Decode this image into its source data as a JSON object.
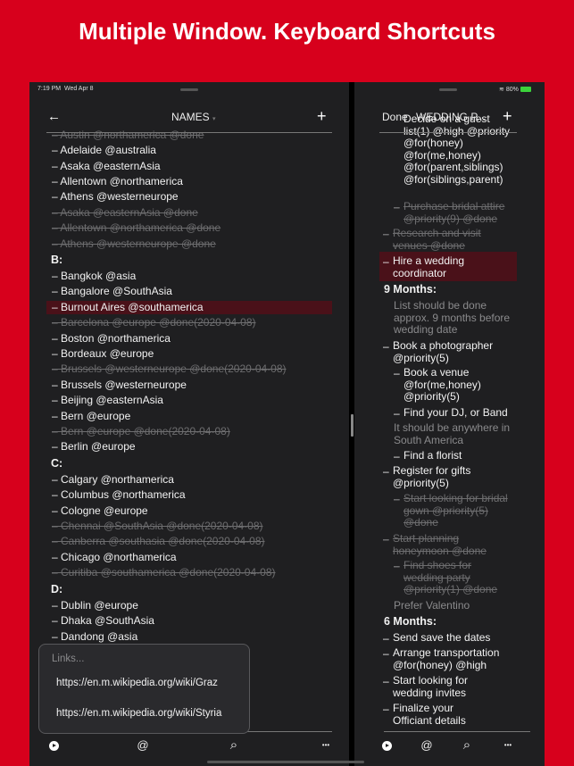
{
  "headline": "Multiple Window. Keyboard Shortcuts",
  "status": {
    "time": "7:19 PM",
    "date": "Wed Apr 8",
    "battery": "80%",
    "wifi_icon": "wifi-icon",
    "battery_icon": "battery-charging-icon"
  },
  "left": {
    "back_icon": "←",
    "title": "NAMES",
    "title_caret": "▾",
    "add": "+",
    "items": [
      {
        "t": "– Austin @northamerica @done",
        "k": "done"
      },
      {
        "t": "– Adelaide @australia",
        "k": "item"
      },
      {
        "t": "– Asaka @easternAsia",
        "k": "item"
      },
      {
        "t": "– Allentown @northamerica",
        "k": "item"
      },
      {
        "t": "– Athens @westerneurope",
        "k": "item"
      },
      {
        "t": "– Asaka @easternAsia  @done",
        "k": "done"
      },
      {
        "t": "– Allentown @northamerica  @done",
        "k": "done"
      },
      {
        "t": "– Athens @westerneurope  @done",
        "k": "done"
      },
      {
        "t": "B:",
        "k": "hdr"
      },
      {
        "t": "– Bangkok @asia",
        "k": "item"
      },
      {
        "t": "– Bangalore @SouthAsia",
        "k": "item"
      },
      {
        "t": "– Burnout Aires @southamerica",
        "k": "sel"
      },
      {
        "t": "– Barcelona @europe @done(2020-04-08)",
        "k": "done"
      },
      {
        "t": "– Boston @northamerica",
        "k": "item"
      },
      {
        "t": "– Bordeaux @europe",
        "k": "item"
      },
      {
        "t": "– Brussels @westerneurope  @done(2020-04-08)",
        "k": "done"
      },
      {
        "t": "– Brussels @westerneurope",
        "k": "item"
      },
      {
        "t": "– Beijing @easternAsia",
        "k": "item"
      },
      {
        "t": "– Bern @europe",
        "k": "item"
      },
      {
        "t": "– Bern @europe  @done(2020-04-08)",
        "k": "done"
      },
      {
        "t": "– Berlin @europe",
        "k": "item"
      },
      {
        "t": "C:",
        "k": "hdr"
      },
      {
        "t": "– Calgary @northamerica",
        "k": "item"
      },
      {
        "t": "– Columbus @northamerica",
        "k": "item"
      },
      {
        "t": "– Cologne @europe",
        "k": "item"
      },
      {
        "t": "– Chennai @SouthAsia  @done(2020-04-08)",
        "k": "done"
      },
      {
        "t": "– Canberra @southasia @done(2020-04-08)",
        "k": "done"
      },
      {
        "t": "– Chicago @northamerica",
        "k": "item"
      },
      {
        "t": "– Curitiba @southamerica  @done(2020-04-08)",
        "k": "done"
      },
      {
        "t": "D:",
        "k": "hdr"
      },
      {
        "t": "– Dublin @europe",
        "k": "item"
      },
      {
        "t": "– Dhaka @SouthAsia",
        "k": "item"
      },
      {
        "t": "– Dandong @asia",
        "k": "item"
      }
    ],
    "popup": {
      "title": "Links...",
      "links": [
        "https://en.m.wikipedia.org/wiki/Graz",
        "https://en.m.wikipedia.org/wiki/Styria"
      ]
    }
  },
  "right": {
    "done": "Done",
    "title": "WEDDING P...",
    "add": "+",
    "items": [
      {
        "lines": [
          "Decide on a guest",
          "list(1) @high @priority",
          "@for(honey)",
          "@for(me,honey)",
          "@for(parent,siblings)",
          "@for(siblings,parent)"
        ],
        "k": "item",
        "dash": ""
      },
      {
        "lines": [
          "Purchase bridal attire",
          "@priority(9) @done"
        ],
        "k": "done",
        "dash": "–"
      },
      {
        "lines": [
          "Research and visit",
          "venues @done"
        ],
        "k": "done",
        "dash": "–"
      },
      {
        "lines": [
          "Hire a wedding",
          "coordinator"
        ],
        "k": "sel",
        "dash": "–"
      },
      {
        "lines": [
          "9 Months:"
        ],
        "k": "hdr",
        "dash": ""
      },
      {
        "lines": [
          "List should be done",
          "approx. 9 months before",
          "wedding date"
        ],
        "k": "note",
        "dash": ""
      },
      {
        "lines": [
          "Book a photographer",
          "@priority(5)"
        ],
        "k": "item",
        "dash": "–"
      },
      {
        "lines": [
          "Book a venue",
          "@for(me,honey)",
          "@priority(5)"
        ],
        "k": "item",
        "dash": "–"
      },
      {
        "lines": [
          "Find your DJ, or Band"
        ],
        "k": "item",
        "dash": "–"
      },
      {
        "lines": [
          "It should be anywhere in",
          "South America"
        ],
        "k": "note",
        "dash": ""
      },
      {
        "lines": [
          "Find a florist"
        ],
        "k": "item",
        "dash": "–"
      },
      {
        "lines": [
          "Register for gifts",
          "@priority(5)"
        ],
        "k": "item",
        "dash": "–"
      },
      {
        "lines": [
          "Start looking for bridal",
          "gown @priority(5)",
          "@done"
        ],
        "k": "done",
        "dash": "–"
      },
      {
        "lines": [
          "Start planning",
          "honeymoon @done"
        ],
        "k": "done",
        "dash": "–"
      },
      {
        "lines": [
          "Find shoes for",
          "wedding party",
          "@priority(1) @done"
        ],
        "k": "done",
        "dash": "–"
      },
      {
        "lines": [
          "Prefer Valentino"
        ],
        "k": "note",
        "dash": ""
      },
      {
        "lines": [
          "6 Months:"
        ],
        "k": "hdr",
        "dash": ""
      },
      {
        "lines": [
          "Send save the dates"
        ],
        "k": "item",
        "dash": "–"
      },
      {
        "lines": [
          "Arrange transportation",
          "@for(honey) @high"
        ],
        "k": "item",
        "dash": "–"
      },
      {
        "lines": [
          "Start looking for",
          "wedding invites"
        ],
        "k": "item",
        "dash": "–"
      },
      {
        "lines": [
          "Finalize your",
          "Officiant details"
        ],
        "k": "item",
        "dash": "–"
      }
    ]
  },
  "toolbar": {
    "play_icon": "play-icon",
    "at": "@",
    "search": "⌕",
    "more": "•••"
  }
}
